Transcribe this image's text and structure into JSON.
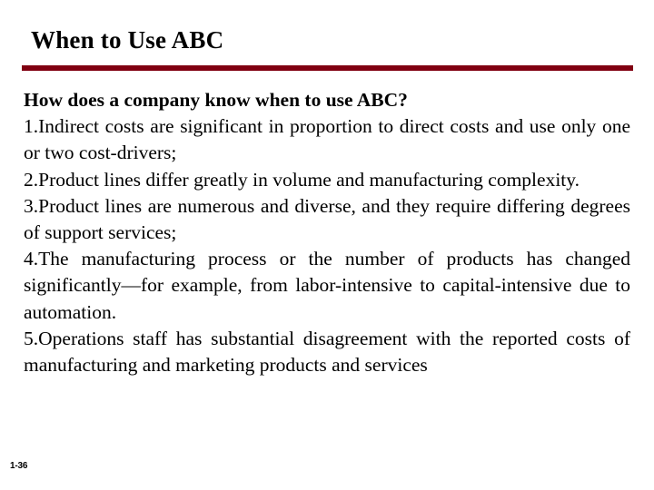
{
  "slide": {
    "title": "When to Use ABC",
    "accent_color": "#800011",
    "background_color": "#ffffff",
    "text_color": "#000000",
    "lead_question": "How does a company know when to use ABC?",
    "items": [
      {
        "number": "1.",
        "text": "Indirect costs are significant in proportion to direct costs and use only one or two cost-drivers;"
      },
      {
        "number": "2.",
        "text": "Product lines differ greatly in volume and manufacturing complexity."
      },
      {
        "number": "3.",
        "text": "Product lines are numerous and diverse, and they require differing degrees of support services;"
      },
      {
        "number": "4.",
        "text": "The manufacturing process or the number of products has changed significantly—for example, from labor-intensive to capital-intensive due to automation."
      },
      {
        "number": "5.",
        "text": "Operations staff has substantial disagreement with the reported costs of manufacturing and marketing products and services"
      }
    ],
    "footer": "1-36"
  }
}
